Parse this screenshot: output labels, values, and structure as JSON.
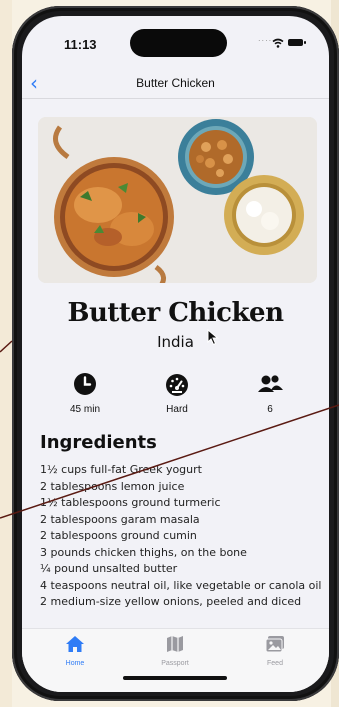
{
  "status_bar": {
    "time": "11:13",
    "signal_dots": "....",
    "icons": [
      "wifi-icon",
      "battery-icon"
    ]
  },
  "nav": {
    "title": "Butter Chicken",
    "back_icon": "chevron-left-icon"
  },
  "recipe": {
    "title": "Butter Chicken",
    "origin": "India",
    "stats": [
      {
        "icon": "clock-icon",
        "value": "45 min"
      },
      {
        "icon": "speedometer-icon",
        "value": "Hard"
      },
      {
        "icon": "people-icon",
        "value": "6"
      }
    ]
  },
  "ingredients": {
    "heading": "Ingredients",
    "items": [
      "1½ cups full-fat Greek yogurt",
      "2 tablespoons lemon juice",
      "1½ tablespoons ground turmeric",
      "2 tablespoons garam masala",
      "2 tablespoons ground cumin",
      "3 pounds chicken thighs, on the bone",
      "¼ pound unsalted butter",
      "4 teaspoons neutral oil, like vegetable or canola oil",
      "2 medium-size yellow onions, peeled and diced"
    ]
  },
  "tabbar": {
    "tabs": [
      {
        "label": "Home",
        "icon": "home-icon",
        "active": true
      },
      {
        "label": "Passport",
        "icon": "map-icon",
        "active": false
      },
      {
        "label": "Feed",
        "icon": "photo-icon",
        "active": false
      }
    ]
  },
  "colors": {
    "accent": "#2f7cf6",
    "inactive": "#9a9aa0",
    "annotation_line": "#5a1a12"
  }
}
